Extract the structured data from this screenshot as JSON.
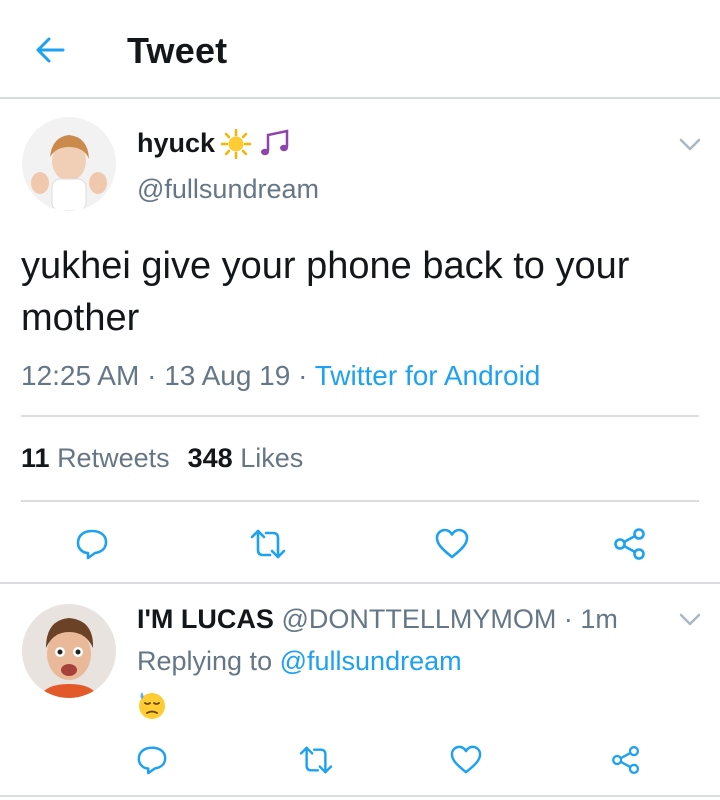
{
  "header": {
    "title": "Tweet"
  },
  "tweet": {
    "display_name": "hyuck",
    "name_emojis": [
      "sun-emoji",
      "music-notes-emoji"
    ],
    "handle": "@fullsundream",
    "text": "yukhei give your phone back to your mother",
    "time": "12:25 AM",
    "dot1": "·",
    "date": "13 Aug 19",
    "dot2": "·",
    "source": "Twitter for Android",
    "retweet_count": "11",
    "retweet_label": "Retweets",
    "like_count": "348",
    "like_label": "Likes"
  },
  "reply": {
    "display_name": "I'M LUCAS",
    "handle": "@DONTTELLMYMOM",
    "dot": "·",
    "time": "1m",
    "replying_prefix": "Replying to",
    "replying_to": "@fullsundream",
    "emoji": "downcast-face-with-sweat-emoji"
  },
  "colors": {
    "accent": "#1da1f2",
    "secondary_text": "#657786",
    "primary_text": "#14171a",
    "divider": "#d9dde0"
  }
}
